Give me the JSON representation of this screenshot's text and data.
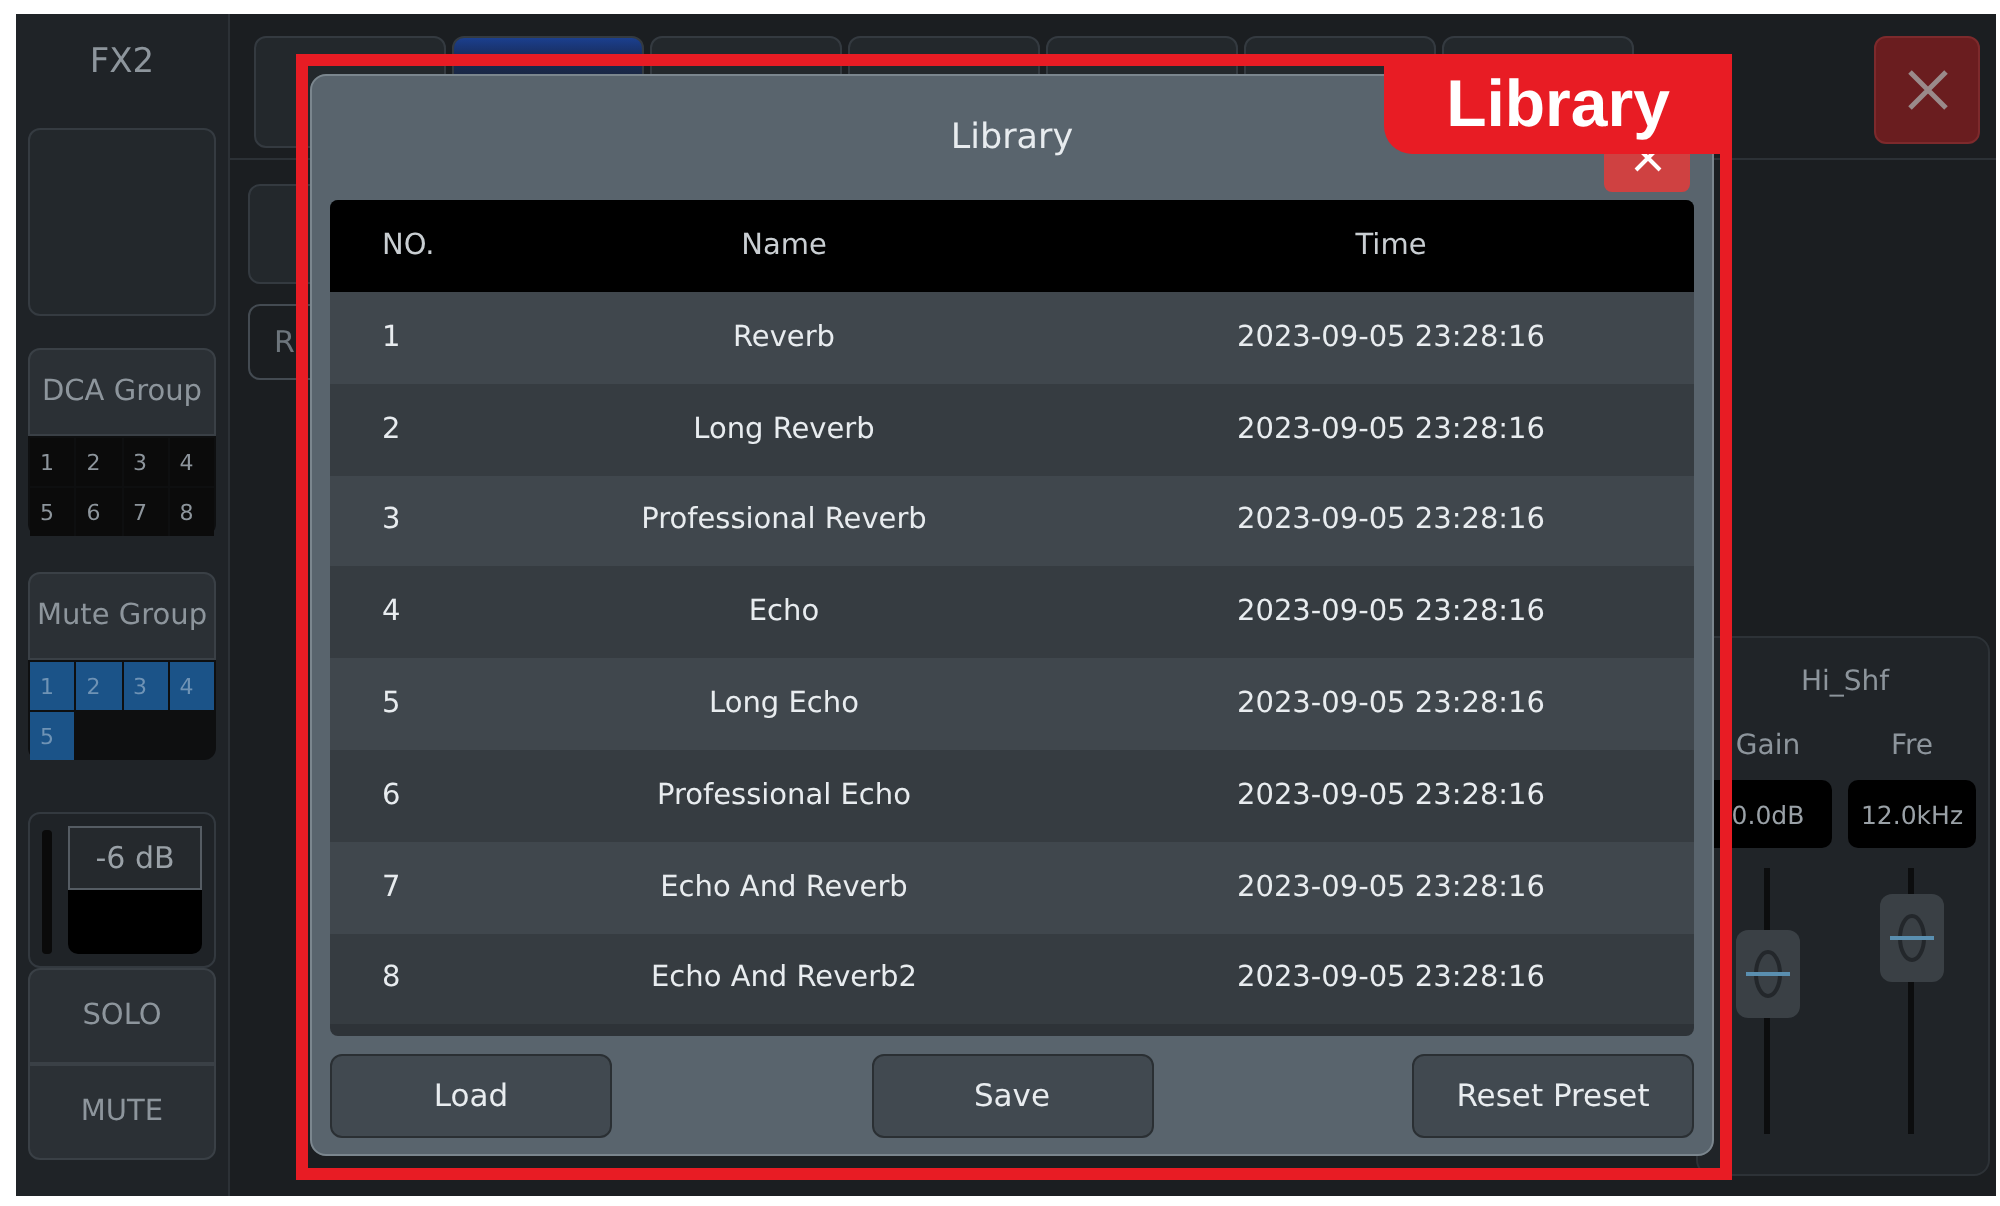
{
  "channel": {
    "name": "FX2"
  },
  "top_buttons": [
    {
      "selected": false
    },
    {
      "selected": true
    },
    {
      "selected": false
    },
    {
      "selected": false
    },
    {
      "selected": false
    },
    {
      "selected": false
    },
    {
      "selected": false
    }
  ],
  "dca_group": {
    "label": "DCA Group",
    "cells": [
      {
        "label": "1",
        "on": false
      },
      {
        "label": "2",
        "on": false
      },
      {
        "label": "3",
        "on": false
      },
      {
        "label": "4",
        "on": false
      },
      {
        "label": "5",
        "on": false
      },
      {
        "label": "6",
        "on": false
      },
      {
        "label": "7",
        "on": false
      },
      {
        "label": "8",
        "on": false
      }
    ]
  },
  "mute_group": {
    "label": "Mute Group",
    "cells": [
      {
        "label": "1",
        "on": true
      },
      {
        "label": "2",
        "on": true
      },
      {
        "label": "3",
        "on": true
      },
      {
        "label": "4",
        "on": true
      },
      {
        "label": "5",
        "on": true
      }
    ]
  },
  "fader_readout": "-6 dB",
  "solo": {
    "label": "SOLO",
    "on": false
  },
  "mute": {
    "label": "MUTE",
    "on": false
  },
  "behind_button": {
    "label": "R"
  },
  "eq_band": {
    "title": "Hi_Shf",
    "controls": [
      {
        "label": "Gain",
        "value": "0.0dB",
        "level": 0.6
      },
      {
        "label": "Fre",
        "value": "12.0kHz",
        "level": 0.74
      }
    ]
  },
  "dialog": {
    "title": "Library",
    "columns": [
      "NO.",
      "Name",
      "Time"
    ],
    "rows": [
      [
        "1",
        "Reverb",
        "2023-09-05 23:28:16"
      ],
      [
        "2",
        "Long Reverb",
        "2023-09-05 23:28:16"
      ],
      [
        "3",
        "Professional Reverb",
        "2023-09-05 23:28:16"
      ],
      [
        "4",
        "Echo",
        "2023-09-05 23:28:16"
      ],
      [
        "5",
        "Long Echo",
        "2023-09-05 23:28:16"
      ],
      [
        "6",
        "Professional Echo",
        "2023-09-05 23:28:16"
      ],
      [
        "7",
        "Echo And Reverb",
        "2023-09-05 23:28:16"
      ],
      [
        "8",
        "Echo And Reverb2",
        "2023-09-05 23:28:16"
      ]
    ],
    "buttons": [
      "Load",
      "Save",
      "Reset Preset"
    ]
  },
  "callout": {
    "label": "Library"
  }
}
